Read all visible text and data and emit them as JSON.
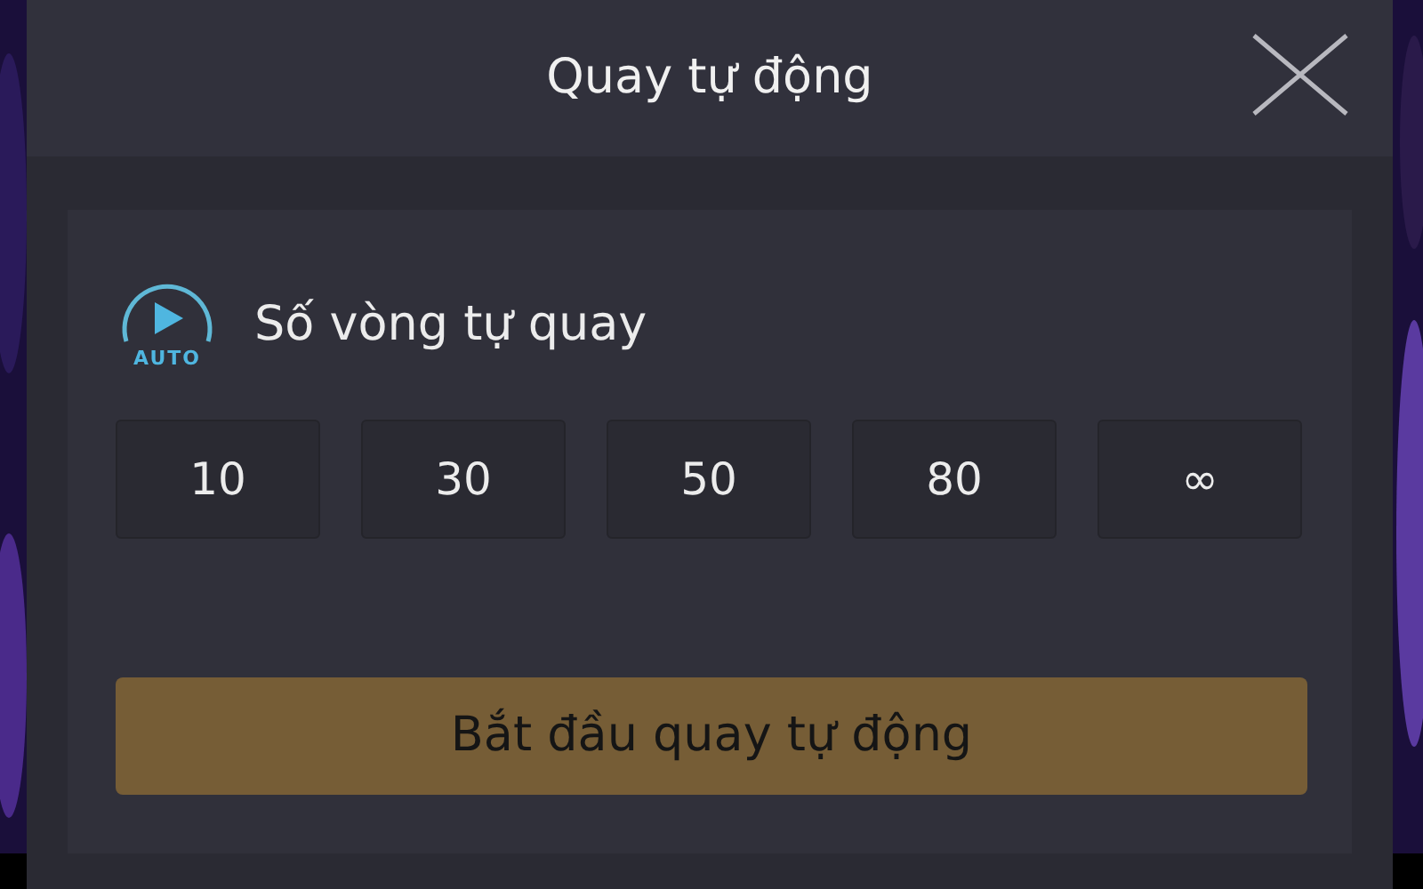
{
  "dialog": {
    "title": "Quay tự động"
  },
  "section": {
    "icon_label": "AUTO",
    "label": "Số vòng tự quay"
  },
  "options": [
    {
      "label": "10"
    },
    {
      "label": "30"
    },
    {
      "label": "50"
    },
    {
      "label": "80"
    },
    {
      "label": "∞"
    }
  ],
  "start_button": {
    "label": "Bắt đầu quay tự động"
  }
}
